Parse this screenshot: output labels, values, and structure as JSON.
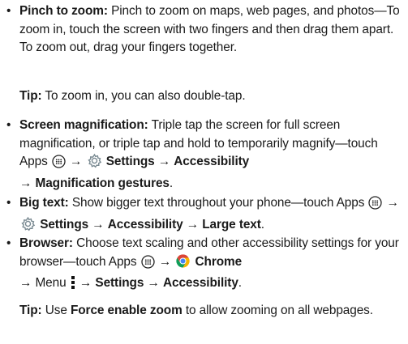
{
  "bullets": {
    "pinch": {
      "title": "Pinch to zoom:",
      "body": " Pinch to zoom on maps, web pages, and photos—To zoom in, touch the screen with two fingers and then drag them apart. To zoom out, drag your fingers together."
    },
    "pinch_tip": {
      "label": "Tip:",
      "body": " To zoom in, you can also double-tap."
    },
    "magnification": {
      "title": "Screen magnification:",
      "body": " Triple tap the screen for full screen magnification, or triple tap and hold to temporarily magnify—touch Apps",
      "arrow1": " → ",
      "settings": "Settings",
      "arrow2": " → ",
      "accessibility": "Accessibility",
      "arrow3": " → ",
      "final": "Magnification gestures",
      "end": "."
    },
    "bigtext": {
      "title": "Big text:",
      "body": " Show bigger text throughout your phone—touch Apps",
      "arrow1": " → ",
      "settings": "Settings",
      "arrow2": " → ",
      "accessibility": "Accessibility",
      "arrow3": " → ",
      "final": "Large text",
      "end": "."
    },
    "browser": {
      "title": "Browser:",
      "body": " Choose text scaling and other accessibility settings for your browser—touch Apps",
      "arrow1": " → ",
      "chrome": "Chrome",
      "arrow2": " → Menu ",
      "arrow3": " → ",
      "settings": "Settings",
      "arrow4": " → ",
      "accessibility": "Accessibility",
      "end": "."
    },
    "browser_tip": {
      "label": "Tip:",
      "body1": " Use ",
      "force": "Force enable zoom",
      "body2": " to allow zooming on all webpages."
    }
  },
  "bullet_char": "•",
  "icons": {
    "apps": "apps-icon",
    "settings": "settings-gear-icon",
    "chrome": "chrome-icon",
    "menu": "menu-dots-icon"
  }
}
